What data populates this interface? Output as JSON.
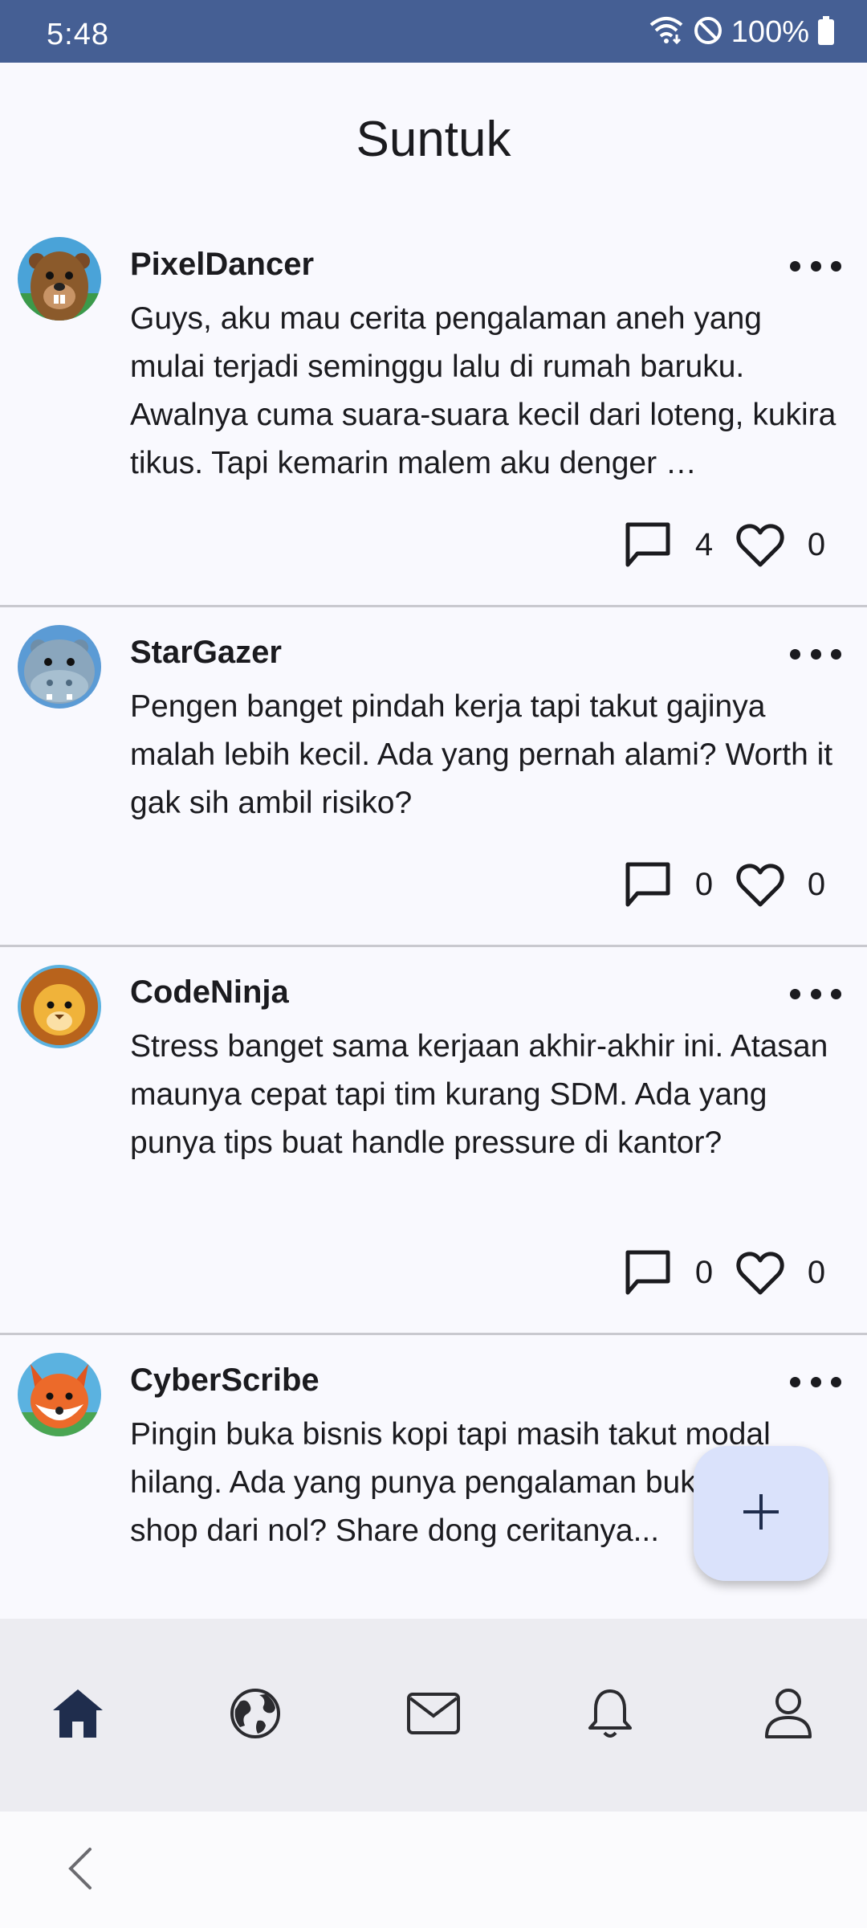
{
  "status_bar": {
    "time": "5:48",
    "battery": "100%",
    "icons": [
      "wifi-icon",
      "do-not-disturb-icon",
      "battery-icon"
    ]
  },
  "app": {
    "title": "Suntuk"
  },
  "posts": [
    {
      "username": "PixelDancer",
      "avatar": "beaver-avatar",
      "text": "Guys, aku mau cerita pengalaman aneh yang mulai terjadi seminggu lalu di rumah baruku. Awalnya cuma suara-suara kecil dari loteng, kukira tikus. Tapi kemarin malem aku denger …",
      "comments": "4",
      "likes": "0"
    },
    {
      "username": "StarGazer",
      "avatar": "hippo-avatar",
      "text": "Pengen banget pindah kerja tapi takut gajinya malah lebih kecil. Ada yang pernah alami? Worth it gak sih ambil risiko?",
      "comments": "0",
      "likes": "0"
    },
    {
      "username": "CodeNinja",
      "avatar": "lion-avatar",
      "text": "Stress banget sama kerjaan akhir-akhir ini. Atasan maunya cepat tapi tim kurang SDM. Ada yang punya tips buat handle pressure di kantor?",
      "comments": "0",
      "likes": "0"
    },
    {
      "username": "CyberScribe",
      "avatar": "fox-avatar",
      "text": "Pingin buka bisnis kopi tapi masih takut modal hilang. Ada yang punya pengalaman buka coffee shop dari nol? Share dong ceritanya...",
      "comments": "",
      "likes": ""
    }
  ],
  "fab": {
    "icon": "plus-icon"
  },
  "bottom_nav": {
    "items": [
      "home-icon",
      "globe-icon",
      "mail-icon",
      "bell-icon",
      "profile-icon"
    ],
    "active": "home-icon"
  },
  "colors": {
    "status_bar": "#455f94",
    "background": "#f9f9fe",
    "fab": "#dae2fb",
    "nav_bar": "#ececf1",
    "text": "#1b1b1f"
  }
}
